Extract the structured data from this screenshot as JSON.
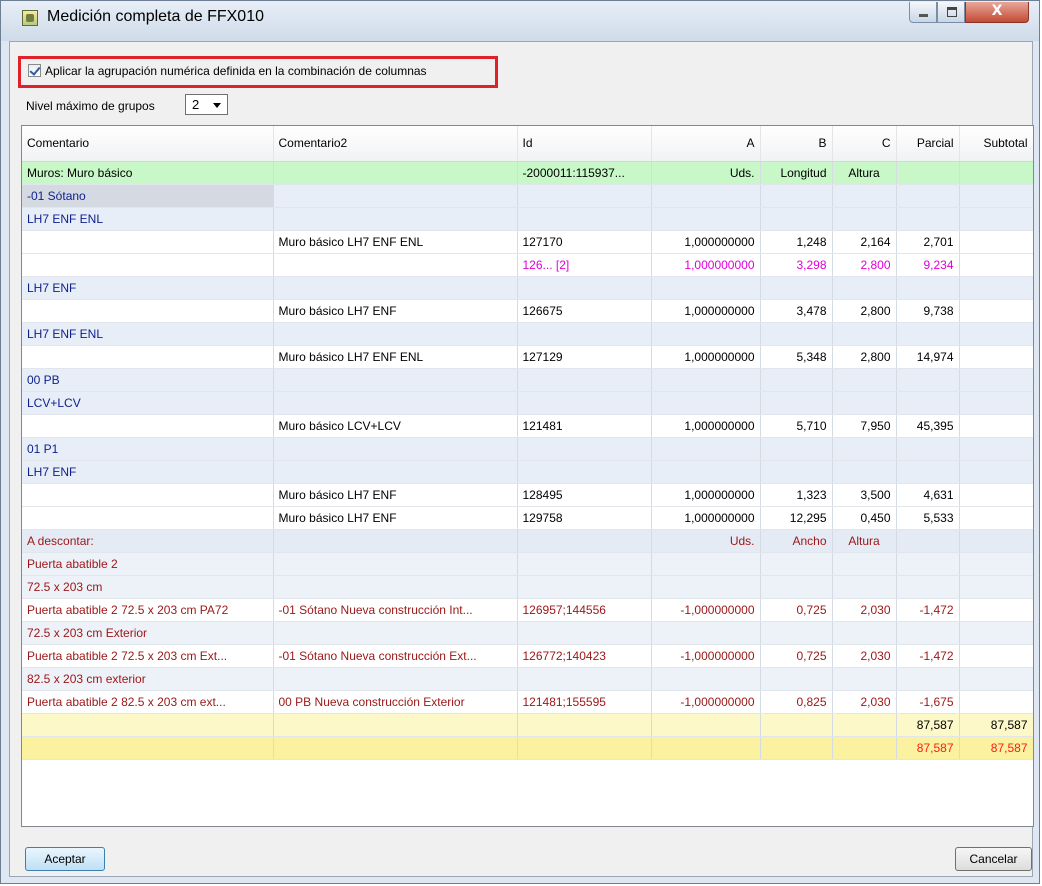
{
  "window": {
    "title": "Medición completa de FFX010",
    "close_glyph": "X",
    "icons": {
      "app": "app-icon",
      "minimize": "minimize-icon",
      "maximize": "maximize-icon",
      "close": "close-icon"
    }
  },
  "options": {
    "apply_grouping_label": "Aplicar la agrupación numérica definida en la combinación de columnas",
    "apply_grouping_checked": true,
    "max_groups_label": "Nivel máximo de grupos",
    "max_groups_value": "2"
  },
  "table": {
    "columns": [
      "Comentario",
      "Comentario2",
      "Id",
      "A",
      "B",
      "C",
      "Parcial",
      "Subtotal"
    ],
    "rows": [
      {
        "type": "header-row",
        "cells": [
          "Muros: Muro básico",
          "",
          "-2000011:115937...",
          "Uds.",
          "Longitud",
          "Altura",
          "",
          ""
        ]
      },
      {
        "type": "group-row",
        "cells": [
          "-01 Sótano",
          "",
          "",
          "",
          "",
          "",
          "",
          ""
        ]
      },
      {
        "type": "group-row",
        "cells": [
          "LH7 ENF ENL",
          "",
          "",
          "",
          "",
          "",
          "",
          ""
        ]
      },
      {
        "type": "data-row",
        "cells": [
          "",
          "Muro básico LH7 ENF ENL",
          "127170",
          "1,000000000",
          "1,248",
          "2,164",
          "2,701",
          ""
        ]
      },
      {
        "type": "data-row magenta",
        "cells": [
          "",
          "",
          "126... [2]",
          "1,000000000",
          "3,298",
          "2,800",
          "9,234",
          ""
        ]
      },
      {
        "type": "group-row",
        "cells": [
          "LH7 ENF",
          "",
          "",
          "",
          "",
          "",
          "",
          ""
        ]
      },
      {
        "type": "data-row",
        "cells": [
          "",
          "Muro básico LH7 ENF",
          "126675",
          "1,000000000",
          "3,478",
          "2,800",
          "9,738",
          ""
        ]
      },
      {
        "type": "group-row",
        "cells": [
          "LH7 ENF ENL",
          "",
          "",
          "",
          "",
          "",
          "",
          ""
        ]
      },
      {
        "type": "data-row",
        "cells": [
          "",
          "Muro básico LH7 ENF ENL",
          "127129",
          "1,000000000",
          "5,348",
          "2,800",
          "14,974",
          ""
        ]
      },
      {
        "type": "group-row",
        "cells": [
          "00 PB",
          "",
          "",
          "",
          "",
          "",
          "",
          ""
        ]
      },
      {
        "type": "group-row",
        "cells": [
          "LCV+LCV",
          "",
          "",
          "",
          "",
          "",
          "",
          ""
        ]
      },
      {
        "type": "data-row",
        "cells": [
          "",
          "Muro básico LCV+LCV",
          "121481",
          "1,000000000",
          "5,710",
          "7,950",
          "45,395",
          ""
        ]
      },
      {
        "type": "group-row",
        "cells": [
          "01 P1",
          "",
          "",
          "",
          "",
          "",
          "",
          ""
        ]
      },
      {
        "type": "group-row",
        "cells": [
          "LH7 ENF",
          "",
          "",
          "",
          "",
          "",
          "",
          ""
        ]
      },
      {
        "type": "data-row",
        "cells": [
          "",
          "Muro básico LH7 ENF",
          "128495",
          "1,000000000",
          "1,323",
          "3,500",
          "4,631",
          ""
        ]
      },
      {
        "type": "data-row",
        "cells": [
          "",
          "Muro básico LH7 ENF",
          "129758",
          "1,000000000",
          "12,295",
          "0,450",
          "5,533",
          ""
        ]
      },
      {
        "type": "ded-header",
        "cells": [
          "A descontar:",
          "",
          "",
          "Uds.",
          "Ancho",
          "Altura",
          "",
          ""
        ]
      },
      {
        "type": "ded-group",
        "cells": [
          "Puerta abatible 2",
          "",
          "",
          "",
          "",
          "",
          "",
          ""
        ]
      },
      {
        "type": "ded-group",
        "cells": [
          "72.5 x 203 cm",
          "",
          "",
          "",
          "",
          "",
          "",
          ""
        ]
      },
      {
        "type": "ded-data",
        "cells": [
          "Puerta abatible 2 72.5 x 203 cm PA72",
          "-01 Sótano Nueva construcción Int...",
          "126957;144556",
          "-1,000000000",
          "0,725",
          "2,030",
          "-1,472",
          ""
        ]
      },
      {
        "type": "ded-group",
        "cells": [
          "72.5 x 203 cm Exterior",
          "",
          "",
          "",
          "",
          "",
          "",
          ""
        ]
      },
      {
        "type": "ded-data",
        "cells": [
          "Puerta abatible 2 72.5 x 203 cm Ext...",
          "-01 Sótano Nueva construcción Ext...",
          "126772;140423",
          "-1,000000000",
          "0,725",
          "2,030",
          "-1,472",
          ""
        ]
      },
      {
        "type": "ded-group",
        "cells": [
          "82.5 x 203 cm exterior",
          "",
          "",
          "",
          "",
          "",
          "",
          ""
        ]
      },
      {
        "type": "ded-data",
        "cells": [
          "Puerta abatible 2 82.5 x 203 cm ext...",
          "00 PB Nueva construcción Exterior",
          "121481;155595",
          "-1,000000000",
          "0,825",
          "2,030",
          "-1,675",
          ""
        ]
      },
      {
        "type": "sub1",
        "cells": [
          "",
          "",
          "",
          "",
          "",
          "",
          "87,587",
          "87,587"
        ]
      },
      {
        "type": "sub2",
        "cells": [
          "",
          "",
          "",
          "",
          "",
          "",
          "87,587",
          "87,587"
        ]
      }
    ]
  },
  "buttons": {
    "accept": "Aceptar",
    "cancel": "Cancelar"
  }
}
